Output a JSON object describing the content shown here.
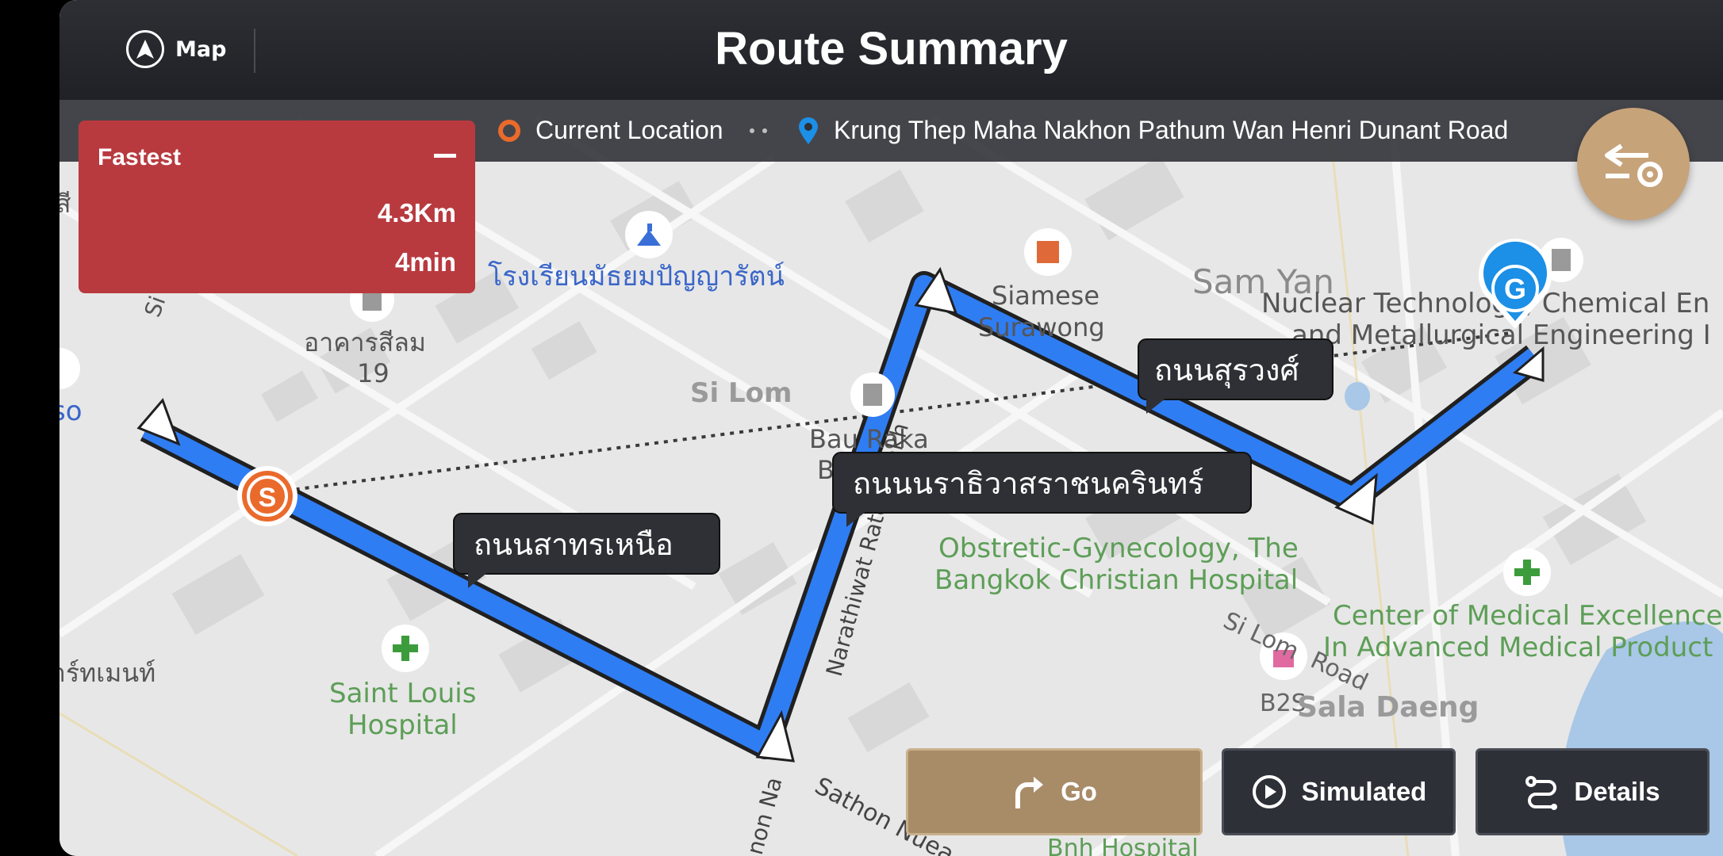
{
  "header": {
    "title": "Route Summary",
    "map_label": "Map"
  },
  "locations": {
    "from": "Current Location",
    "to": "Krung Thep Maha Nakhon Pathum Wan Henri Dunant Road"
  },
  "route_card": {
    "label": "Fastest",
    "distance": "4.3Km",
    "time": "4min"
  },
  "buttons": {
    "go": "Go",
    "simulated": "Simulated",
    "details": "Details"
  },
  "markers": {
    "start": "S",
    "goal": "G"
  },
  "road_callouts": {
    "sathon_nuea": "ถนนสาทรเหนือ",
    "narathiwat": "ถนนนราธิวาสราชนครินทร์",
    "surawong": "ถนนสุรวงศ์"
  },
  "map_labels": {
    "school": "โรงเรียนมัธยมปัญญารัตน์",
    "building_silom": "อาคารสีลม",
    "building_silom_num": "19",
    "siamese": "Siamese",
    "surawong": "Surawong",
    "sam_yan": "Sam Yan",
    "nuclear_1": "Nuclear Technology, Chemical En",
    "nuclear_2": "and Metallurgical Engineering I",
    "si_lom": "Si Lom",
    "bau_raka": "Bau Raka",
    "bau_raka_b": "B",
    "obstetric_1": "Obstretic-Gynecology, The",
    "obstetric_2": "Bangkok Christian Hospital",
    "center_1": "Center of Medical Excellence",
    "center_2": "In Advanced Medical Product",
    "st_louis_1": "Saint Louis",
    "st_louis_2": "Hospital",
    "si_lom_road_1": "Si Lom",
    "si_lom_road_2": "Road",
    "b2s": "B2S",
    "sala_daeng": "Sala Daeng",
    "narathiwat_road": "Narathiwat Ratchanakh",
    "narathiwat_road_2": "non Na",
    "sathon_road": "Sathon Nuea",
    "bnh": "Bnh Hospital",
    "left_so": "so",
    "left_thai": "าร์ทเมนท์",
    "left_thai_top": "สี",
    "left_si": "Si"
  },
  "colors": {
    "route": "#2f7df3",
    "card": "#b83a3f",
    "go": "#a88c68",
    "fab": "#c7a37a",
    "start_marker": "#ea6a2c",
    "goal_marker": "#1c8fe6",
    "poi_green": "#3c9c3c",
    "label_green": "#5d9e57"
  }
}
